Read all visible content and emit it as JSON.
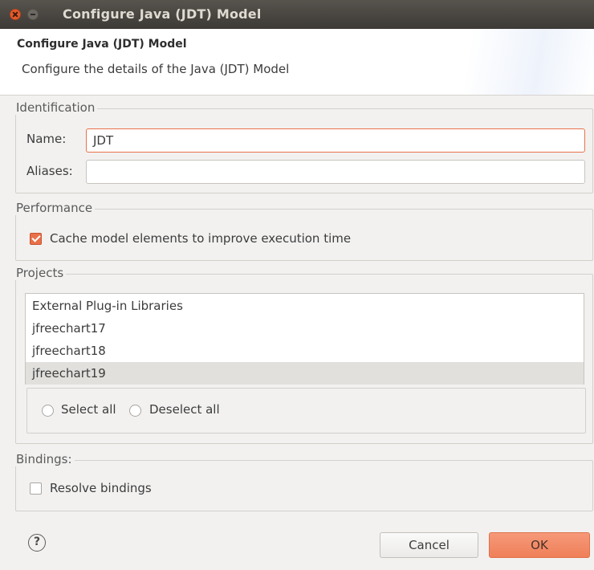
{
  "window": {
    "title": "Configure Java (JDT) Model"
  },
  "header": {
    "title": "Configure Java (JDT) Model",
    "description": "Configure the details of the Java (JDT) Model"
  },
  "identification": {
    "legend": "Identification",
    "name_label": "Name:",
    "name_value": "JDT",
    "aliases_label": "Aliases:",
    "aliases_value": ""
  },
  "performance": {
    "legend": "Performance",
    "cache_label": "Cache model elements to improve execution time",
    "cache_checked": true
  },
  "projects": {
    "legend": "Projects",
    "items": [
      {
        "label": "External Plug-in Libraries",
        "selected": false
      },
      {
        "label": "jfreechart17",
        "selected": false
      },
      {
        "label": "jfreechart18",
        "selected": false
      },
      {
        "label": "jfreechart19",
        "selected": true
      }
    ],
    "select_all_label": "Select all",
    "deselect_all_label": "Deselect all"
  },
  "bindings": {
    "legend": "Bindings:",
    "resolve_label": "Resolve bindings",
    "resolve_checked": false
  },
  "footer": {
    "help_symbol": "?",
    "cancel_label": "Cancel",
    "ok_label": "OK"
  },
  "colors": {
    "accent": "#e9714a",
    "titlebar": "#3d3a36",
    "background": "#f2f1f0"
  }
}
